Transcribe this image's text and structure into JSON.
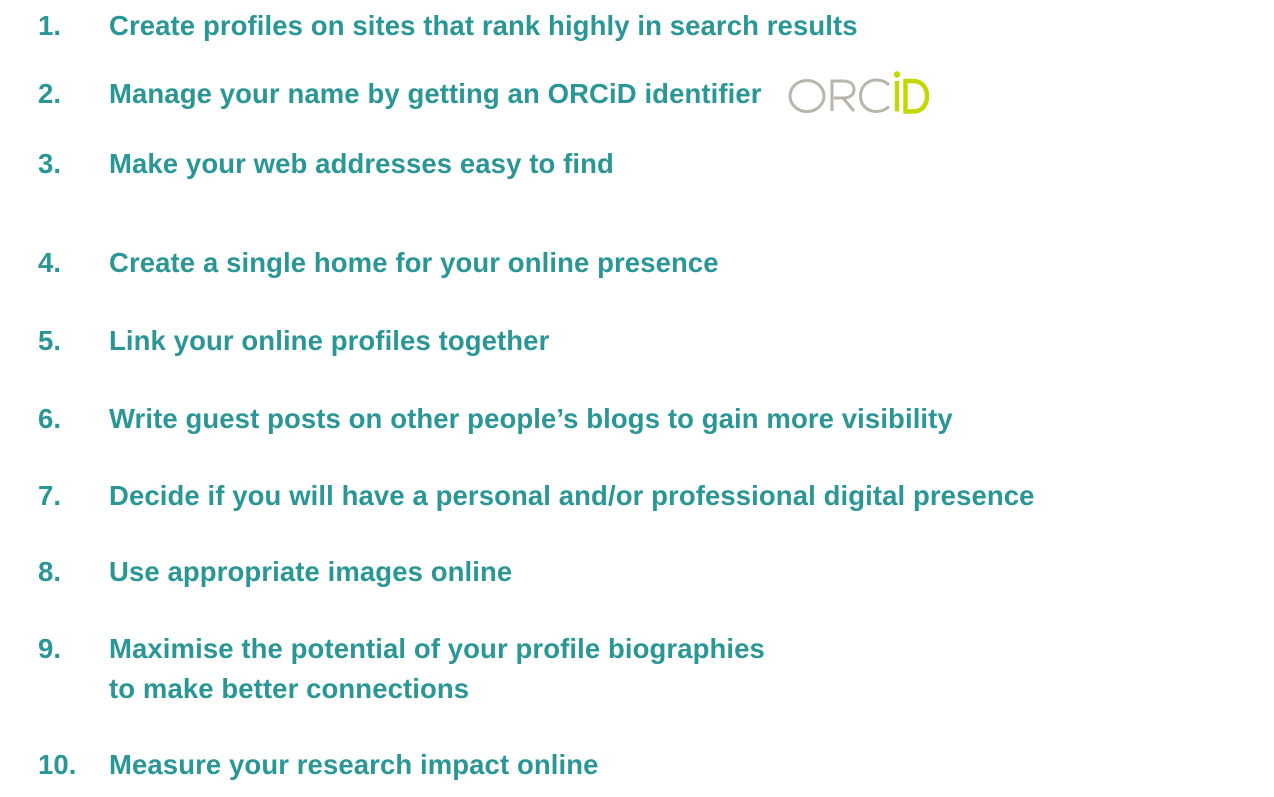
{
  "items": [
    {
      "num": "1.",
      "text": "Create profiles on sites that rank highly in search results"
    },
    {
      "num": "2.",
      "text": "Manage your name by getting an ORCiD identifier"
    },
    {
      "num": "3.",
      "text": "Make your web addresses easy to find"
    },
    {
      "num": "4.",
      "text": "Create a single home for your online presence"
    },
    {
      "num": "5.",
      "text": "Link your online profiles together"
    },
    {
      "num": "6.",
      "text": "Write guest posts on other people’s blogs to gain more visibility"
    },
    {
      "num": "7.",
      "text": "Decide if you will have a personal and/or professional digital presence"
    },
    {
      "num": "8.",
      "text": "Use appropriate images online"
    },
    {
      "num": "9.",
      "text": "Maximise the potential of your profile biographies",
      "text2": "to make better connections"
    },
    {
      "num": "10.",
      "text": "Measure your research impact online"
    }
  ],
  "logo": {
    "text_grey": "ORC",
    "text_green": "iD",
    "color_grey": "#b9b5ab",
    "color_green": "#c4d600"
  },
  "colors": {
    "text": "#2b9696"
  }
}
